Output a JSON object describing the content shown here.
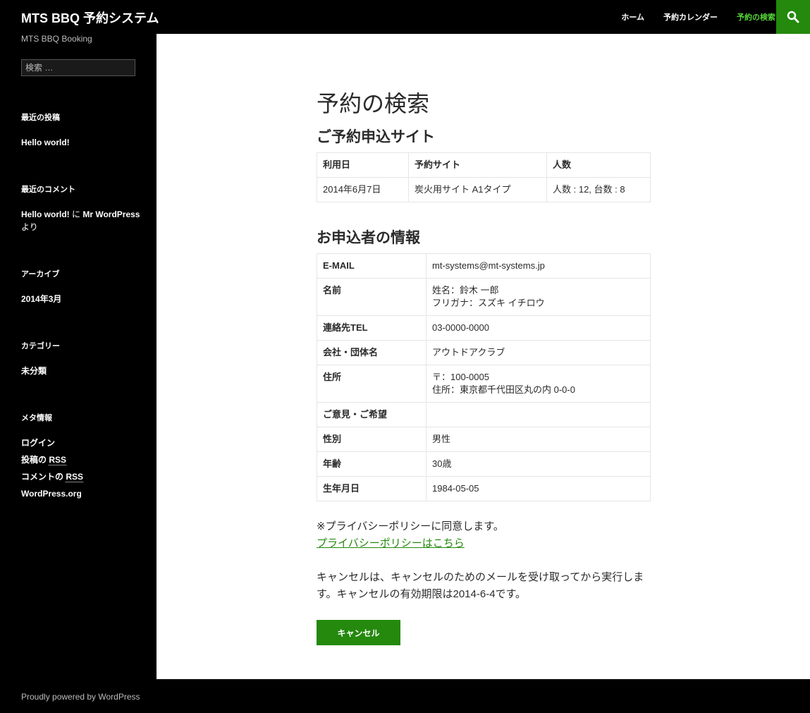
{
  "site": {
    "title": "MTS BBQ 予約システム",
    "description": "MTS BBQ Booking"
  },
  "nav": {
    "items": [
      "ホーム",
      "予約カレンダー",
      "予約の検索"
    ],
    "current_index": 2
  },
  "sidebar": {
    "search_placeholder": "検索 …",
    "recent_posts_title": "最近の投稿",
    "recent_post": "Hello world!",
    "recent_comments_title": "最近のコメント",
    "comment_post": "Hello world!",
    "comment_connector": " に ",
    "comment_author": "Mr WordPress",
    "comment_suffix": "より",
    "archives_title": "アーカイブ",
    "archive_item": "2014年3月",
    "categories_title": "カテゴリー",
    "category_item": "未分類",
    "meta_title": "メタ情報",
    "meta_login": "ログイン",
    "meta_posts_rss_prefix": "投稿の ",
    "meta_comments_rss_prefix": "コメントの ",
    "meta_rss": "RSS",
    "meta_wporg": "WordPress.org"
  },
  "main": {
    "page_title": "予約の検索",
    "booking_heading": "ご予約申込サイト",
    "booking_table": {
      "headers": [
        "利用日",
        "予約サイト",
        "人数"
      ],
      "row": [
        "2014年6月7日",
        "炭火用サイト A1タイプ",
        "人数 : 12, 台数 : 8"
      ]
    },
    "applicant_heading": "お申込者の情報",
    "applicant_rows": [
      {
        "label": "E-MAIL",
        "lines": [
          "mt-systems@mt-systems.jp"
        ]
      },
      {
        "label": "名前",
        "lines": [
          "姓名：鈴木 一郎",
          "フリガナ：スズキ イチロウ"
        ]
      },
      {
        "label": "連絡先TEL",
        "lines": [
          "03-0000-0000"
        ]
      },
      {
        "label": "会社・団体名",
        "lines": [
          "アウトドアクラブ"
        ]
      },
      {
        "label": "住所",
        "lines": [
          "〒：100-0005",
          "住所：東京都千代田区丸の内 0-0-0"
        ]
      },
      {
        "label": "ご意見・ご希望",
        "lines": [
          ""
        ]
      },
      {
        "label": "性別",
        "lines": [
          "男性"
        ]
      },
      {
        "label": "年齢",
        "lines": [
          "30歳"
        ]
      },
      {
        "label": "生年月日",
        "lines": [
          "1984-05-05"
        ]
      }
    ],
    "privacy_note": "※プライバシーポリシーに同意します。",
    "privacy_link": "プライバシーポリシーはこちら",
    "cancel_note": "キャンセルは、キャンセルのためのメールを受け取ってから実行します。キャンセルの有効期限は2014-6-4です。",
    "cancel_button": "キャンセル"
  },
  "footer": {
    "text": "Proudly powered by WordPress"
  },
  "colors": {
    "accent": "#24890d",
    "nav_current": "#55d737"
  }
}
